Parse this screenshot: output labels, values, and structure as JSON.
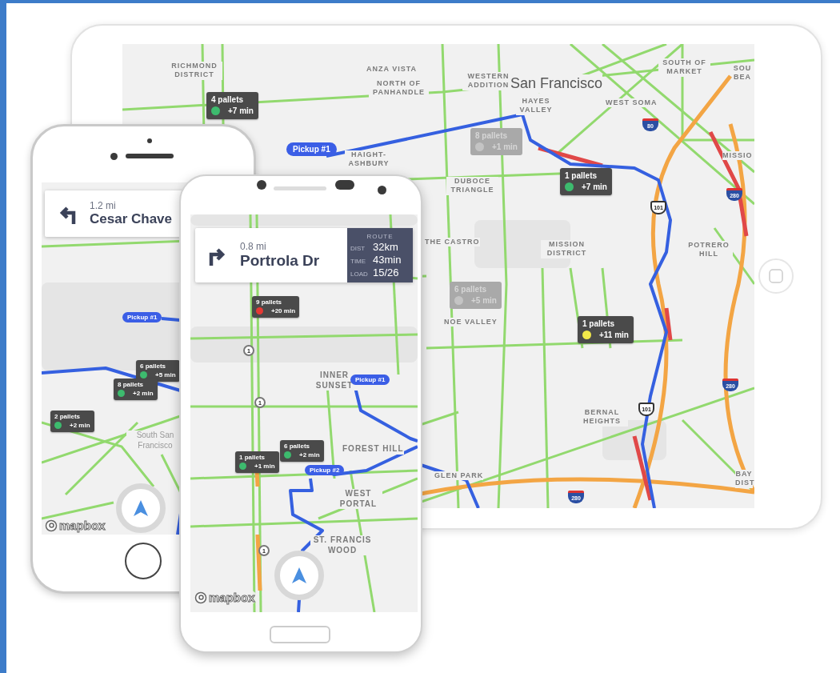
{
  "tablet": {
    "labels": [
      {
        "text": "RICHMOND DISTRICT",
        "kind": "district"
      },
      {
        "text": "ANZA VISTA",
        "kind": "district"
      },
      {
        "text": "NORTH OF PANHANDLE",
        "kind": "district"
      },
      {
        "text": "WESTERN ADDITION",
        "kind": "district"
      },
      {
        "text": "San Francisco",
        "kind": "city"
      },
      {
        "text": "SOUTH OF MARKET",
        "kind": "district"
      },
      {
        "text": "SOU BEA",
        "kind": "district"
      },
      {
        "text": "HAYES VALLEY",
        "kind": "district"
      },
      {
        "text": "WEST SOMA",
        "kind": "district"
      },
      {
        "text": "HAIGHT-ASHBURY",
        "kind": "district"
      },
      {
        "text": "DUBOCE TRIANGLE",
        "kind": "district"
      },
      {
        "text": "MISSIO",
        "kind": "district"
      },
      {
        "text": "THE CASTRO",
        "kind": "district"
      },
      {
        "text": "MISSION DISTRICT",
        "kind": "district"
      },
      {
        "text": "POTRERO HILL",
        "kind": "district"
      },
      {
        "text": "NOE VALLEY",
        "kind": "district"
      },
      {
        "text": "BERNAL HEIGHTS",
        "kind": "district"
      },
      {
        "text": "GLEN PARK",
        "kind": "district"
      },
      {
        "text": "BAY DIST",
        "kind": "district"
      }
    ],
    "markers": [
      {
        "pallets": "4 pallets",
        "delay": "+7 min",
        "color": "#3dbb6e",
        "faded": false
      },
      {
        "pallets": "8 pallets",
        "delay": "+1 min",
        "color": "#c4c4c4",
        "faded": true
      },
      {
        "pallets": "1 pallets",
        "delay": "+7 min",
        "color": "#3dbb6e",
        "faded": false
      },
      {
        "pallets": "6 pallets",
        "delay": "+5 min",
        "color": "#c4c4c4",
        "faded": true
      },
      {
        "pallets": "1 pallets",
        "delay": "+11 min",
        "color": "#f2e84a",
        "faded": false
      }
    ],
    "pickups": [
      {
        "text": "Pickup #1"
      }
    ],
    "shields": [
      {
        "text": "80",
        "kind": "interstate"
      },
      {
        "text": "101",
        "kind": "us"
      },
      {
        "text": "280",
        "kind": "interstate"
      },
      {
        "text": "280",
        "kind": "interstate"
      },
      {
        "text": "101",
        "kind": "us"
      },
      {
        "text": "280",
        "kind": "interstate"
      }
    ]
  },
  "phone_left": {
    "nav": {
      "distance": "1.2 mi",
      "street": "Cesar Chave",
      "kind": "left"
    },
    "labels": [
      {
        "text": "South San Francisco",
        "kind": "city"
      }
    ],
    "markers": [
      {
        "pallets": "6 pallets",
        "delay": "+5 min",
        "color": "#3dbb6e",
        "faded": false
      },
      {
        "pallets": "8 pallets",
        "delay": "+2 min",
        "color": "#3dbb6e",
        "faded": false
      },
      {
        "pallets": "2 pallets",
        "delay": "+2 min",
        "color": "#3dbb6e",
        "faded": false
      }
    ],
    "pickups": [
      {
        "text": "Pickup #1"
      }
    ],
    "attribution": "mapbox"
  },
  "phone_right": {
    "nav": {
      "distance": "0.8 mi",
      "street": "Portrola Dr",
      "kind": "right"
    },
    "route": {
      "title": "ROUTE",
      "rows": [
        {
          "label": "DIST",
          "value": "32km"
        },
        {
          "label": "TIME",
          "value": "43min"
        },
        {
          "label": "LOAD",
          "value": "15/26"
        }
      ]
    },
    "labels": [
      {
        "text": "INNER SUNSET",
        "kind": "district"
      },
      {
        "text": "FOREST HILL",
        "kind": "district"
      },
      {
        "text": "WEST PORTAL",
        "kind": "district"
      },
      {
        "text": "ST. FRANCIS WOOD",
        "kind": "district"
      }
    ],
    "markers": [
      {
        "pallets": "9 pallets",
        "delay": "+20 min",
        "color": "#e53935",
        "faded": false
      },
      {
        "pallets": "6 pallets",
        "delay": "+2 min",
        "color": "#3dbb6e",
        "faded": false
      },
      {
        "pallets": "1 pallets",
        "delay": "+1 min",
        "color": "#3dbb6e",
        "faded": false
      }
    ],
    "pickups": [
      {
        "text": "Pickup #1"
      },
      {
        "text": "Pickup #2"
      }
    ],
    "shields": [
      {
        "text": "1",
        "kind": "state"
      },
      {
        "text": "1",
        "kind": "state"
      },
      {
        "text": "1",
        "kind": "state"
      }
    ],
    "attribution": "mapbox"
  }
}
